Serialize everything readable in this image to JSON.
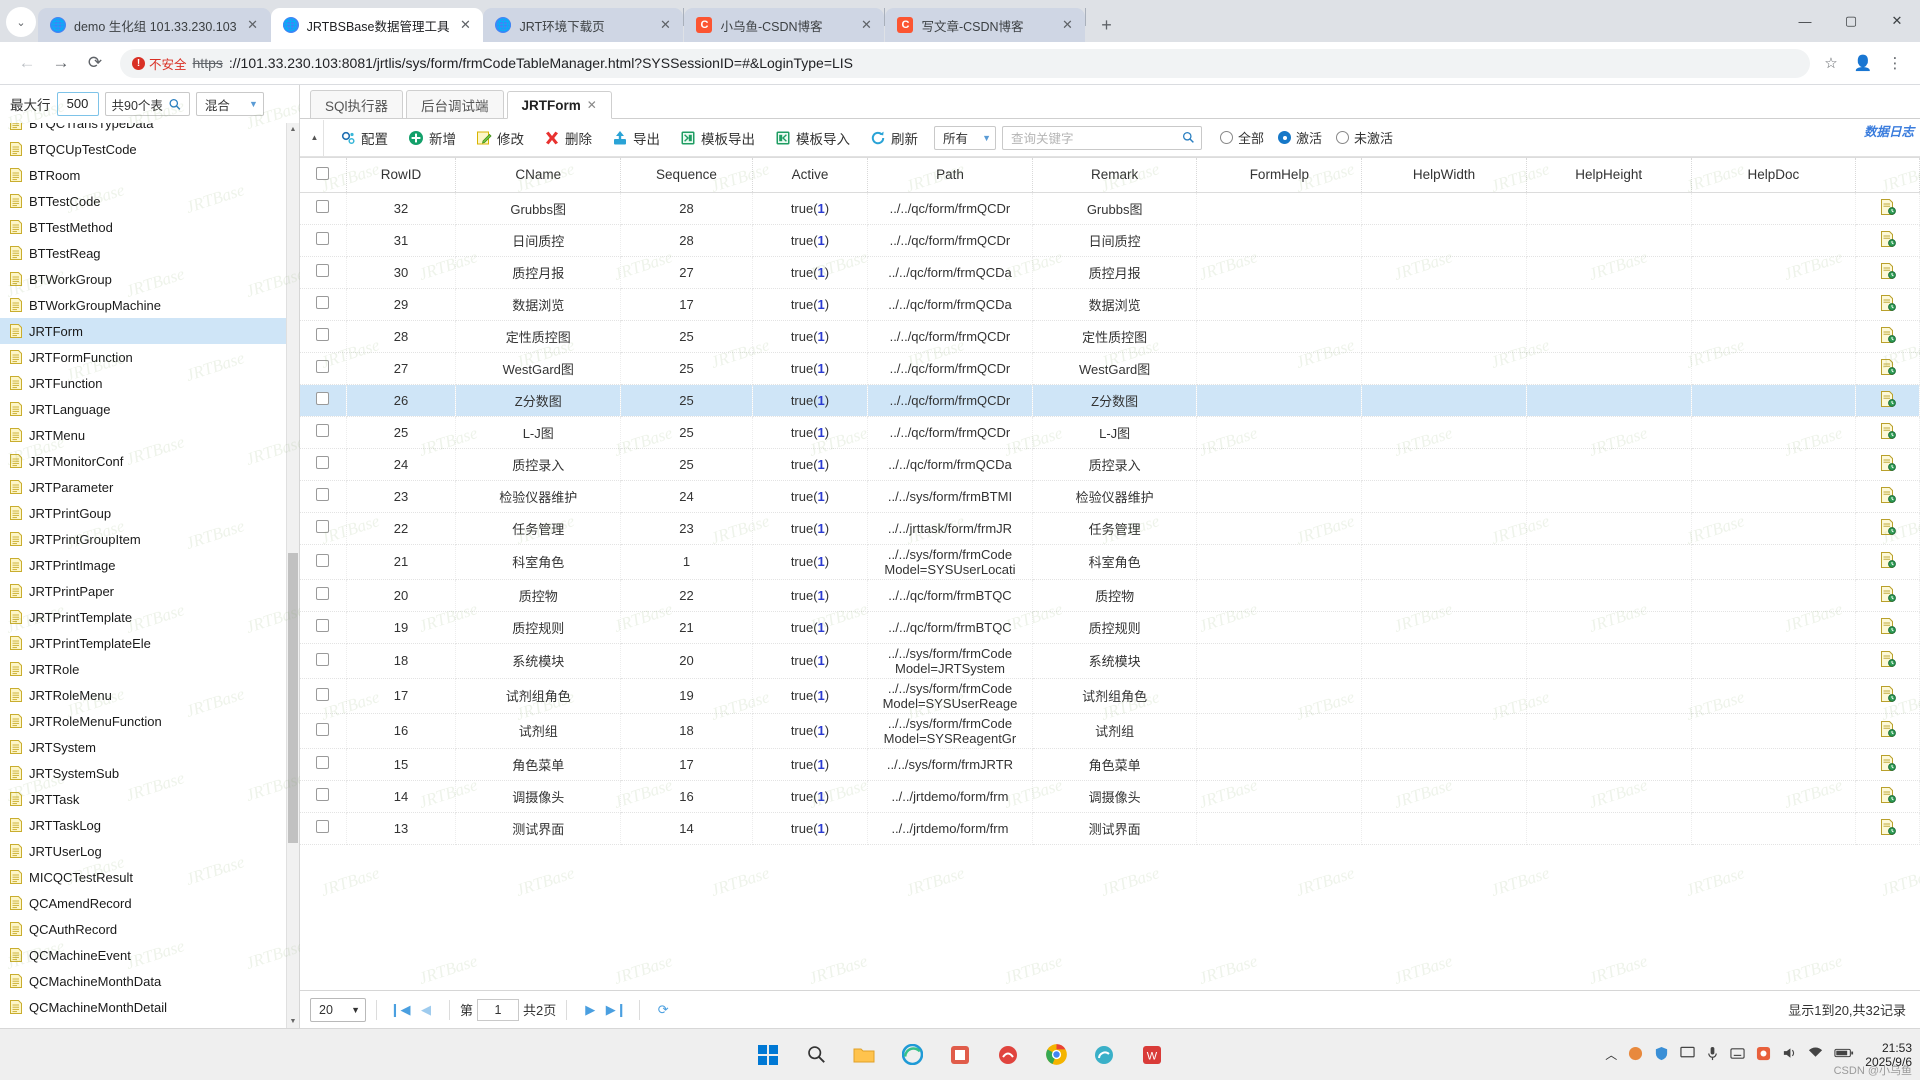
{
  "browser": {
    "tabs": [
      {
        "title": "demo 生化组 101.33.230.103",
        "favicon": "globe-icon",
        "active": false
      },
      {
        "title": "JRTBSBase数据管理工具",
        "favicon": "globe-icon",
        "active": true
      },
      {
        "title": "JRT环境下载页",
        "favicon": "globe-icon",
        "active": false
      },
      {
        "title": "小乌鱼-CSDN博客",
        "favicon": "csdn-icon",
        "active": false
      },
      {
        "title": "写文章-CSDN博客",
        "favicon": "csdn-icon",
        "active": false
      }
    ],
    "new_tab_label": "+",
    "tab_close_label": "✕",
    "tab_list_chevron": "⌄",
    "window_controls": {
      "minimize": "—",
      "maximize": "▢",
      "close": "✕"
    },
    "nav": {
      "back": "←",
      "forward": "→",
      "reload": "⟳"
    },
    "security_label": "不安全",
    "security_icon": "not-secure-icon",
    "url_scheme": "https",
    "url_rest": "://101.33.230.103:8081/jrtlis/sys/form/frmCodeTableManager.html?SYSSessionID=#&LoginType=LIS",
    "star_icon": "☆",
    "profile_icon": "👤",
    "menu_icon": "⋮"
  },
  "left_panel": {
    "max_row_label": "最大行",
    "max_row_value": "500",
    "table_count_label": "共90个表",
    "search_icon": "search-icon",
    "filter_value": "混合",
    "tables": [
      "BTQCTransTypeData",
      "BTQCUpTestCode",
      "BTRoom",
      "BTTestCode",
      "BTTestMethod",
      "BTTestReag",
      "BTWorkGroup",
      "BTWorkGroupMachine",
      "JRTForm",
      "JRTFormFunction",
      "JRTFunction",
      "JRTLanguage",
      "JRTMenu",
      "JRTMonitorConf",
      "JRTParameter",
      "JRTPrintGoup",
      "JRTPrintGroupItem",
      "JRTPrintImage",
      "JRTPrintPaper",
      "JRTPrintTemplate",
      "JRTPrintTemplateEle",
      "JRTRole",
      "JRTRoleMenu",
      "JRTRoleMenuFunction",
      "JRTSystem",
      "JRTSystemSub",
      "JRTTask",
      "JRTTaskLog",
      "JRTUserLog",
      "MICQCTestResult",
      "QCAmendRecord",
      "QCAuthRecord",
      "QCMachineEvent",
      "QCMachineMonthData",
      "QCMachineMonthDetail"
    ],
    "selected_table": "JRTForm"
  },
  "app_tabs": [
    {
      "label": "SQl执行器",
      "active": false,
      "closable": false
    },
    {
      "label": "后台调试端",
      "active": false,
      "closable": false
    },
    {
      "label": "JRTForm",
      "active": true,
      "closable": true
    }
  ],
  "toolbar": {
    "collapse_icon": "chevron-up-icon",
    "buttons": [
      {
        "label": "配置",
        "icon": "gear-icon"
      },
      {
        "label": "新增",
        "icon": "plus-circle-icon"
      },
      {
        "label": "修改",
        "icon": "edit-icon"
      },
      {
        "label": "删除",
        "icon": "delete-x-icon"
      },
      {
        "label": "导出",
        "icon": "upload-icon"
      },
      {
        "label": "模板导出",
        "icon": "excel-export-icon"
      },
      {
        "label": "模板导入",
        "icon": "excel-import-icon"
      },
      {
        "label": "刷新",
        "icon": "refresh-icon"
      }
    ],
    "scope_select": "所有",
    "search_placeholder": "查询关键字",
    "search_value": "",
    "search_icon": "search-icon",
    "radios": [
      {
        "label": "全部",
        "checked": false
      },
      {
        "label": "激活",
        "checked": true
      },
      {
        "label": "未激活",
        "checked": false
      }
    ],
    "log_link": "数据日志"
  },
  "grid": {
    "columns": [
      "RowID",
      "CName",
      "Sequence",
      "Active",
      "Path",
      "Remark",
      "FormHelp",
      "HelpWidth",
      "HelpHeight",
      "HelpDoc"
    ],
    "rows": [
      {
        "RowID": "32",
        "CName": "Grubbs图",
        "Sequence": "28",
        "Active": "true(1)",
        "Path": "../../qc/form/frmQCDr",
        "Remark": "Grubbs图",
        "FormHelp": "",
        "HelpWidth": "",
        "HelpHeight": "",
        "HelpDoc": "",
        "selected": false
      },
      {
        "RowID": "31",
        "CName": "日间质控",
        "Sequence": "28",
        "Active": "true(1)",
        "Path": "../../qc/form/frmQCDr",
        "Remark": "日间质控",
        "FormHelp": "",
        "HelpWidth": "",
        "HelpHeight": "",
        "HelpDoc": "",
        "selected": false
      },
      {
        "RowID": "30",
        "CName": "质控月报",
        "Sequence": "27",
        "Active": "true(1)",
        "Path": "../../qc/form/frmQCDa",
        "Remark": "质控月报",
        "FormHelp": "",
        "HelpWidth": "",
        "HelpHeight": "",
        "HelpDoc": "",
        "selected": false
      },
      {
        "RowID": "29",
        "CName": "数据浏览",
        "Sequence": "17",
        "Active": "true(1)",
        "Path": "../../qc/form/frmQCDa",
        "Remark": "数据浏览",
        "FormHelp": "",
        "HelpWidth": "",
        "HelpHeight": "",
        "HelpDoc": "",
        "selected": false
      },
      {
        "RowID": "28",
        "CName": "定性质控图",
        "Sequence": "25",
        "Active": "true(1)",
        "Path": "../../qc/form/frmQCDr",
        "Remark": "定性质控图",
        "FormHelp": "",
        "HelpWidth": "",
        "HelpHeight": "",
        "HelpDoc": "",
        "selected": false
      },
      {
        "RowID": "27",
        "CName": "WestGard图",
        "Sequence": "25",
        "Active": "true(1)",
        "Path": "../../qc/form/frmQCDr",
        "Remark": "WestGard图",
        "FormHelp": "",
        "HelpWidth": "",
        "HelpHeight": "",
        "HelpDoc": "",
        "selected": false
      },
      {
        "RowID": "26",
        "CName": "Z分数图",
        "Sequence": "25",
        "Active": "true(1)",
        "Path": "../../qc/form/frmQCDr",
        "Remark": "Z分数图",
        "FormHelp": "",
        "HelpWidth": "",
        "HelpHeight": "",
        "HelpDoc": "",
        "selected": true
      },
      {
        "RowID": "25",
        "CName": "L-J图",
        "Sequence": "25",
        "Active": "true(1)",
        "Path": "../../qc/form/frmQCDr",
        "Remark": "L-J图",
        "FormHelp": "",
        "HelpWidth": "",
        "HelpHeight": "",
        "HelpDoc": "",
        "selected": false
      },
      {
        "RowID": "24",
        "CName": "质控录入",
        "Sequence": "25",
        "Active": "true(1)",
        "Path": "../../qc/form/frmQCDa",
        "Remark": "质控录入",
        "FormHelp": "",
        "HelpWidth": "",
        "HelpHeight": "",
        "HelpDoc": "",
        "selected": false
      },
      {
        "RowID": "23",
        "CName": "检验仪器维护",
        "Sequence": "24",
        "Active": "true(1)",
        "Path": "../../sys/form/frmBTMI",
        "Remark": "检验仪器维护",
        "FormHelp": "",
        "HelpWidth": "",
        "HelpHeight": "",
        "HelpDoc": "",
        "selected": false
      },
      {
        "RowID": "22",
        "CName": "任务管理",
        "Sequence": "23",
        "Active": "true(1)",
        "Path": "../../jrttask/form/frmJR",
        "Remark": "任务管理",
        "FormHelp": "",
        "HelpWidth": "",
        "HelpHeight": "",
        "HelpDoc": "",
        "selected": false
      },
      {
        "RowID": "21",
        "CName": "科室角色",
        "Sequence": "1",
        "Active": "true(1)",
        "Path": "../../sys/form/frmCode\nModel=SYSUserLocati",
        "Remark": "科室角色",
        "FormHelp": "",
        "HelpWidth": "",
        "HelpHeight": "",
        "HelpDoc": "",
        "selected": false
      },
      {
        "RowID": "20",
        "CName": "质控物",
        "Sequence": "22",
        "Active": "true(1)",
        "Path": "../../qc/form/frmBTQC",
        "Remark": "质控物",
        "FormHelp": "",
        "HelpWidth": "",
        "HelpHeight": "",
        "HelpDoc": "",
        "selected": false
      },
      {
        "RowID": "19",
        "CName": "质控规则",
        "Sequence": "21",
        "Active": "true(1)",
        "Path": "../../qc/form/frmBTQC",
        "Remark": "质控规则",
        "FormHelp": "",
        "HelpWidth": "",
        "HelpHeight": "",
        "HelpDoc": "",
        "selected": false
      },
      {
        "RowID": "18",
        "CName": "系统模块",
        "Sequence": "20",
        "Active": "true(1)",
        "Path": "../../sys/form/frmCode\nModel=JRTSystem",
        "Remark": "系统模块",
        "FormHelp": "",
        "HelpWidth": "",
        "HelpHeight": "",
        "HelpDoc": "",
        "selected": false
      },
      {
        "RowID": "17",
        "CName": "试剂组角色",
        "Sequence": "19",
        "Active": "true(1)",
        "Path": "../../sys/form/frmCode\nModel=SYSUserReage",
        "Remark": "试剂组角色",
        "FormHelp": "",
        "HelpWidth": "",
        "HelpHeight": "",
        "HelpDoc": "",
        "selected": false
      },
      {
        "RowID": "16",
        "CName": "试剂组",
        "Sequence": "18",
        "Active": "true(1)",
        "Path": "../../sys/form/frmCode\nModel=SYSReagentGr",
        "Remark": "试剂组",
        "FormHelp": "",
        "HelpWidth": "",
        "HelpHeight": "",
        "HelpDoc": "",
        "selected": false
      },
      {
        "RowID": "15",
        "CName": "角色菜单",
        "Sequence": "17",
        "Active": "true(1)",
        "Path": "../../sys/form/frmJRTR",
        "Remark": "角色菜单",
        "FormHelp": "",
        "HelpWidth": "",
        "HelpHeight": "",
        "HelpDoc": "",
        "selected": false
      },
      {
        "RowID": "14",
        "CName": "调摄像头",
        "Sequence": "16",
        "Active": "true(1)",
        "Path": "../../jrtdemo/form/frm",
        "Remark": "调摄像头",
        "FormHelp": "",
        "HelpWidth": "",
        "HelpHeight": "",
        "HelpDoc": "",
        "selected": false
      },
      {
        "RowID": "13",
        "CName": "测试界面",
        "Sequence": "14",
        "Active": "true(1)",
        "Path": "../../jrtdemo/form/frm",
        "Remark": "测试界面",
        "FormHelp": "",
        "HelpWidth": "",
        "HelpHeight": "",
        "HelpDoc": "",
        "selected": false
      }
    ],
    "row_action_icon": "doc-clock-icon"
  },
  "pager": {
    "page_size": "20",
    "first_icon": "first-page-icon",
    "prev_icon": "prev-page-icon",
    "page_prefix": "第",
    "page_number": "1",
    "page_total": "共2页",
    "next_icon": "next-page-icon",
    "last_icon": "last-page-icon",
    "reload_icon": "reload-icon",
    "summary": "显示1到20,共32记录"
  },
  "watermark_text": "JRTBase",
  "taskbar": {
    "apps": [
      {
        "name": "start-icon"
      },
      {
        "name": "search-icon"
      },
      {
        "name": "file-explorer-icon"
      },
      {
        "name": "edge-icon"
      },
      {
        "name": "app-icon"
      },
      {
        "name": "app2-icon"
      },
      {
        "name": "chrome-icon"
      },
      {
        "name": "app3-icon"
      },
      {
        "name": "wps-icon"
      }
    ],
    "tray": [
      {
        "name": "chevron-up-icon"
      },
      {
        "name": "app-tray-icon"
      },
      {
        "name": "shield-icon"
      },
      {
        "name": "monitor-icon"
      },
      {
        "name": "mic-icon"
      },
      {
        "name": "ime-icon"
      },
      {
        "name": "sogou-icon"
      },
      {
        "name": "volume-icon"
      },
      {
        "name": "network-icon"
      },
      {
        "name": "battery-icon"
      }
    ],
    "time": "21:53",
    "date": "2025/9/6",
    "watermark": "CSDN @小乌鱼"
  },
  "colors": {
    "accent": "#1678c8",
    "selection": "#cfe5f7",
    "link": "#3b7ddd",
    "danger": "#d93025",
    "chrome_tabstrip": "#dee1e6"
  }
}
